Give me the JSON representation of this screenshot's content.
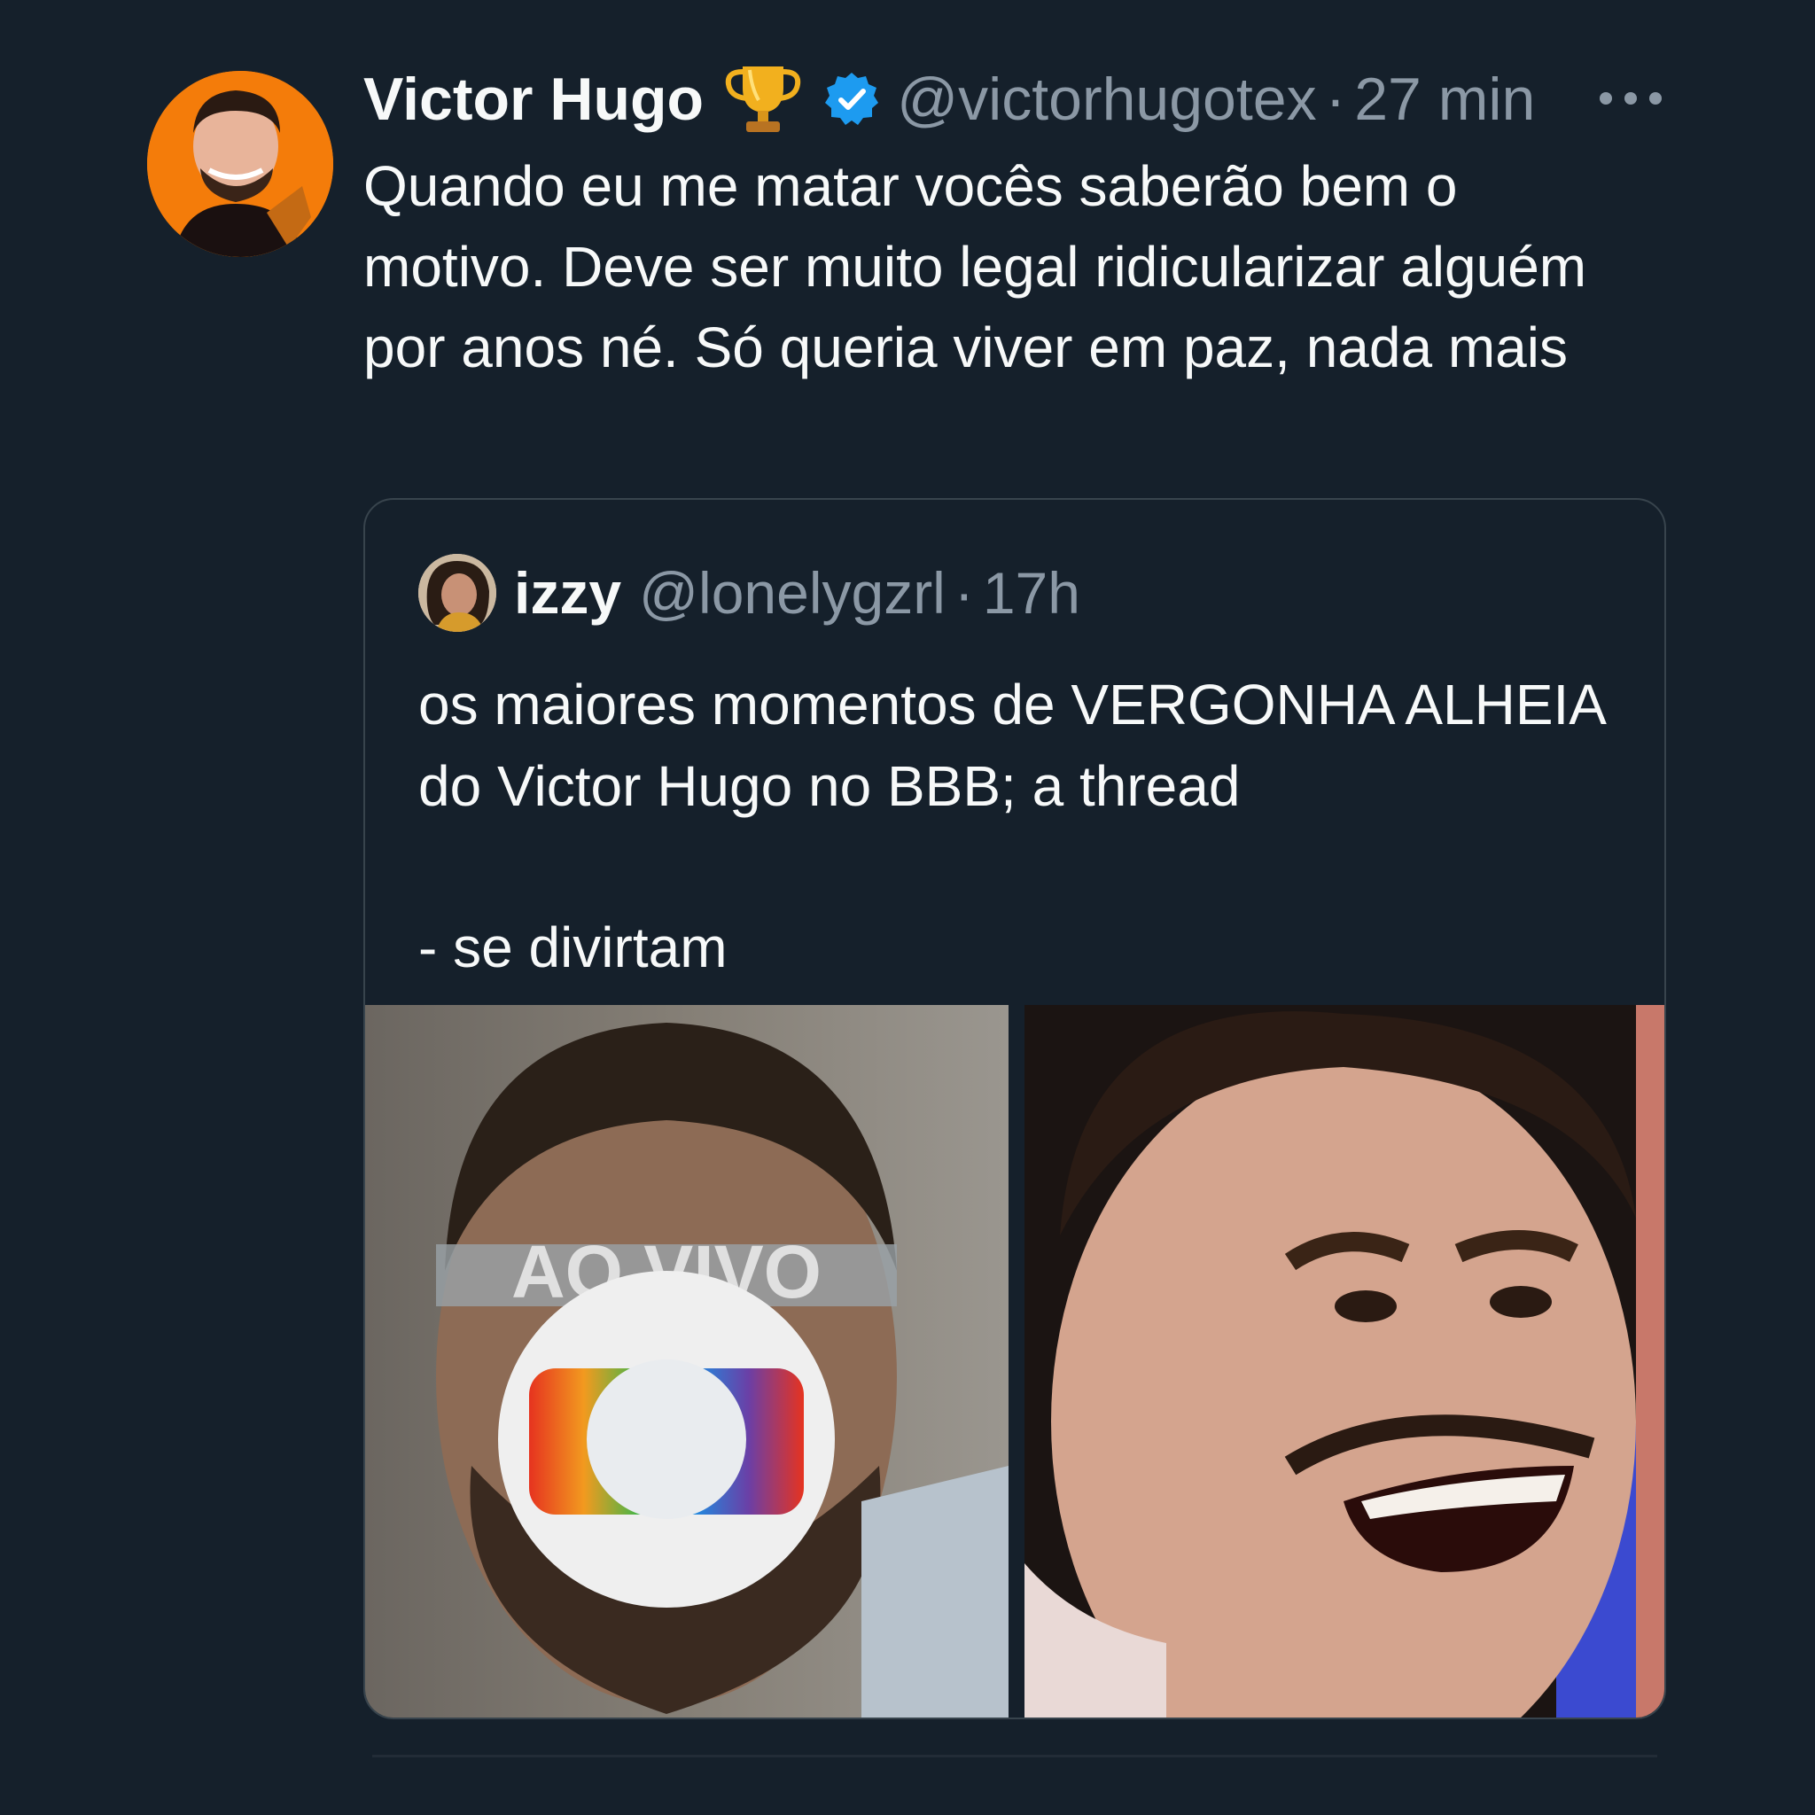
{
  "tweet": {
    "author": {
      "display_name": "Victor Hugo",
      "badge_emoji": "🏆",
      "verified_icon": "verified-badge-icon",
      "handle": "@victorhugotex",
      "separator": "·",
      "time": "27 min"
    },
    "more_icon": "more-options-icon",
    "text": "Quando eu me matar vocês saberão bem o motivo. Deve ser muito legal ridicularizar alguém por anos né. Só queria viver em paz, nada mais"
  },
  "quoted_tweet": {
    "author": {
      "display_name": "izzy",
      "handle": "@lonelygzrl",
      "separator": "·",
      "time": "17h"
    },
    "text_line1": "os maiores momentos de VERGONHA ALHEIA do Victor Hugo no BBB; a thread",
    "text_line2": "- se divirtam",
    "media": [
      {
        "alt": "photo-1",
        "overlay_text": "AO VIVO"
      },
      {
        "alt": "photo-2"
      }
    ]
  },
  "colors": {
    "background": "#15202b",
    "primary_text": "#f7f9f9",
    "secondary_text": "#8b98a5",
    "verified_blue": "#1d9bf0",
    "card_border": "#38444d"
  }
}
